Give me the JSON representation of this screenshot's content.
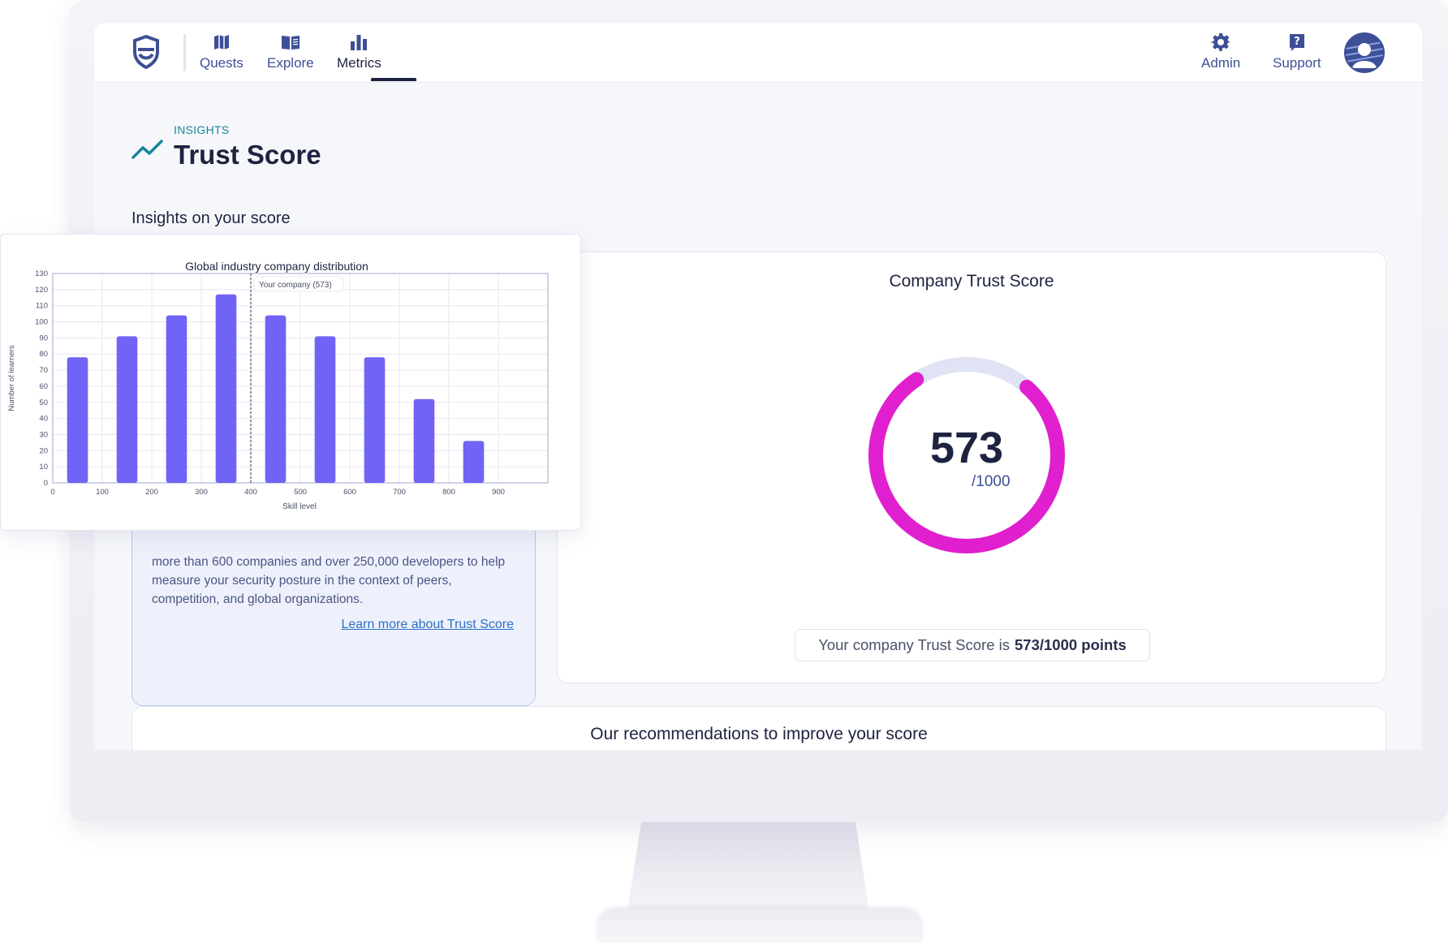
{
  "nav": {
    "items": [
      {
        "label": "Quests",
        "icon": "map-icon"
      },
      {
        "label": "Explore",
        "icon": "book-icon"
      },
      {
        "label": "Metrics",
        "icon": "bar-chart-icon",
        "active": true
      }
    ],
    "right_items": [
      {
        "label": "Admin",
        "icon": "gear-icon"
      },
      {
        "label": "Support",
        "icon": "question-icon"
      }
    ]
  },
  "header": {
    "kicker": "INSIGHTS",
    "title": "Trust Score"
  },
  "section": {
    "title": "Insights on your score"
  },
  "info": {
    "text": "more than 600 companies and over 250,000 developers to help measure your security posture in the context of peers, competition, and global organizations.",
    "link": "Learn more about Trust Score"
  },
  "score": {
    "title": "Company Trust Score",
    "value": "573",
    "max": "/1000",
    "fraction": 0.573,
    "summary_prefix": "Your company Trust Score is",
    "summary_bold": "573/1000 points",
    "colors": {
      "arc": "#e01fcf",
      "track": "#dfe3f3"
    }
  },
  "recommendations": {
    "title": "Our recommendations to improve your score"
  },
  "chart_data": {
    "type": "bar",
    "title": "Global industry company distribution",
    "xlabel": "Skill level",
    "ylabel": "Number of learners",
    "x": [
      50,
      150,
      250,
      350,
      450,
      550,
      650,
      750,
      850
    ],
    "values": [
      78,
      91,
      104,
      117,
      104,
      91,
      78,
      52,
      26
    ],
    "xlim": [
      0,
      1000
    ],
    "ylim": [
      0,
      130
    ],
    "x_ticks": [
      0,
      100,
      200,
      300,
      400,
      500,
      600,
      700,
      800,
      900
    ],
    "y_ticks": [
      0,
      10,
      20,
      30,
      40,
      50,
      60,
      70,
      80,
      90,
      100,
      110,
      120,
      130
    ],
    "annotation": {
      "x": 400,
      "label": "Your company (573)"
    },
    "grid": true,
    "bar_color": "#7063f5"
  }
}
